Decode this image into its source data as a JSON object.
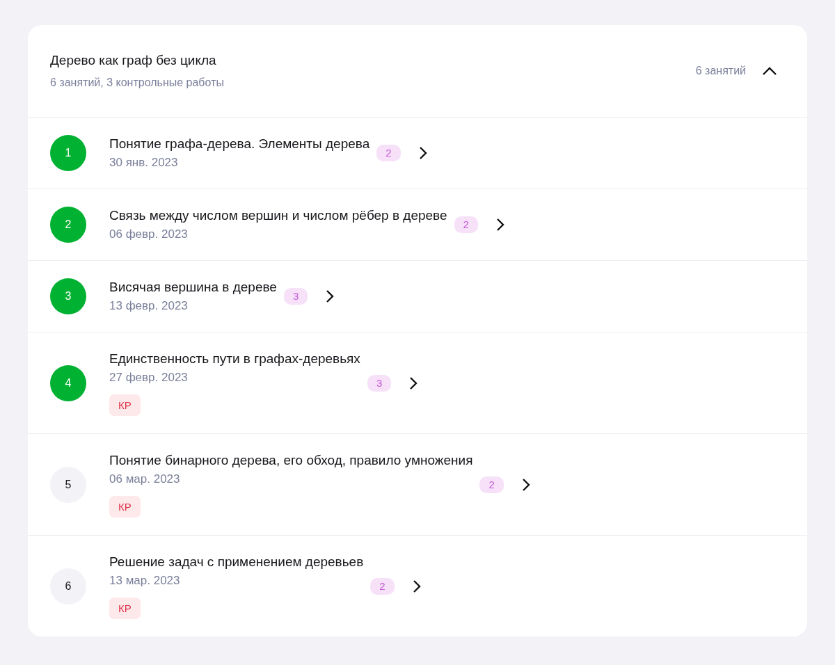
{
  "module": {
    "title": "Дерево как граф без цикла",
    "subtitle": "6 занятий, 3 контрольные работы",
    "count": "6 занятий",
    "expanded": true
  },
  "lessons": [
    {
      "number": "1",
      "title": "Понятие графа-дерева. Элементы дерева",
      "date": "30 янв. 2023",
      "badge": "2",
      "completed": true
    },
    {
      "number": "2",
      "title": "Связь между числом вершин и числом рёбер в дереве",
      "date": "06 февр. 2023",
      "badge": "2",
      "completed": true
    },
    {
      "number": "3",
      "title": "Висячая вершина в дереве",
      "date": "13 февр. 2023",
      "badge": "3",
      "completed": true
    },
    {
      "number": "4",
      "title": "Единственность пути в графах-деревьях",
      "date": "27 февр. 2023",
      "badge": "3",
      "completed": true,
      "tag": "КР"
    },
    {
      "number": "5",
      "title": "Понятие бинарного дерева, его обход, правило умножения",
      "date": "06 мар. 2023",
      "badge": "2",
      "completed": false,
      "tag": "КР"
    },
    {
      "number": "6",
      "title": "Решение задач с применением деревьев",
      "date": "13 мар. 2023",
      "badge": "2",
      "completed": false,
      "tag": "КР"
    }
  ]
}
